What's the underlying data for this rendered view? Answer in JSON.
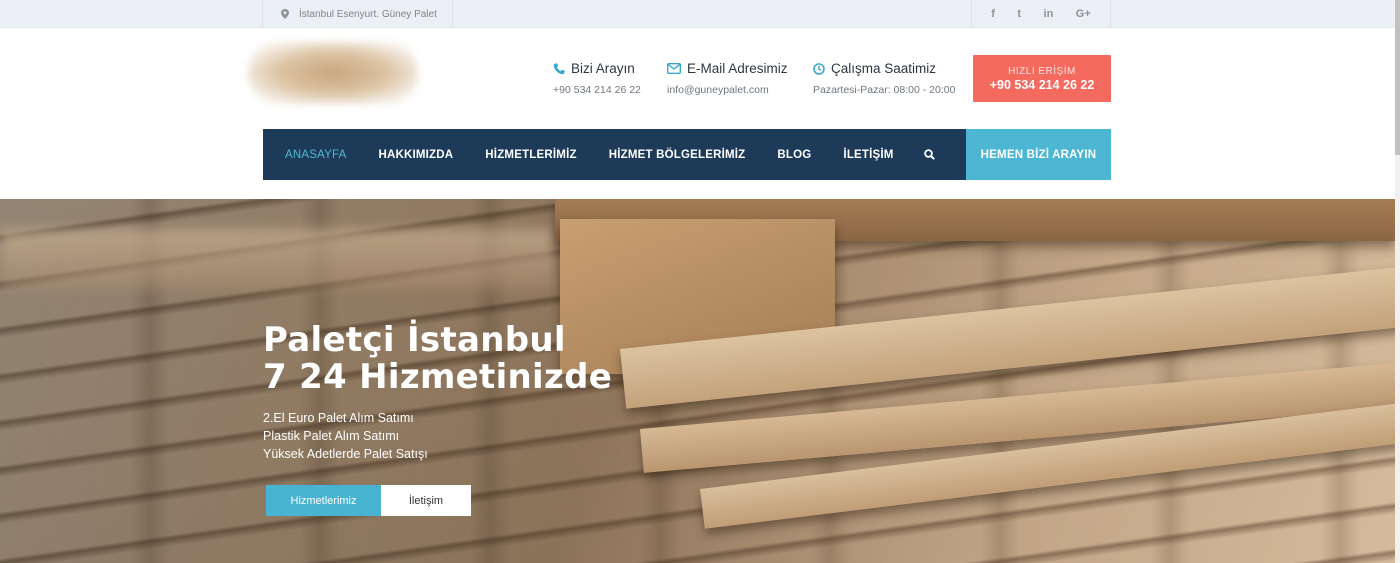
{
  "topbar": {
    "address": "İstanbul Esenyurt. Güney Palet",
    "social": [
      {
        "icon": "facebook-icon",
        "glyph": "f"
      },
      {
        "icon": "twitter-icon",
        "glyph": "t"
      },
      {
        "icon": "linkedin-icon",
        "glyph": "in"
      },
      {
        "icon": "google-plus-icon",
        "glyph": "G+"
      }
    ]
  },
  "header": {
    "phone": {
      "title": "Bizi Arayın",
      "value": "+90 534 214 26 22"
    },
    "email": {
      "title": "E-Mail Adresimiz",
      "value": "info@guneypalet.com"
    },
    "hours": {
      "title": "Çalışma Saatimiz",
      "value": "Pazartesi-Pazar: 08:00 - 20:00"
    },
    "quick_access": {
      "label": "HIZLI ERİŞİM",
      "number": "+90 534 214 26 22"
    }
  },
  "nav": {
    "items": [
      "ANASAYFA",
      "HAKKIMIZDA",
      "HİZMETLERİMİZ",
      "HİZMET BÖLGELERİMİZ",
      "BLOG",
      "İLETİŞİM"
    ],
    "cta": "HEMEN BİZİ ARAYIN"
  },
  "hero": {
    "title_line1": "Paletçi İstanbul",
    "title_line2": "7 24 Hizmetinizde",
    "lines": [
      "2.El Euro Palet Alım Satımı",
      "Plastik Palet Alım Satımı",
      "Yüksek Adetlerde Palet Satışı"
    ],
    "button_primary": "Hizmetlerimiz",
    "button_secondary": "İletişim"
  },
  "colors": {
    "nav_bg": "#1d3a59",
    "accent": "#4cb6d3",
    "quick_bg": "#f56a5e"
  }
}
